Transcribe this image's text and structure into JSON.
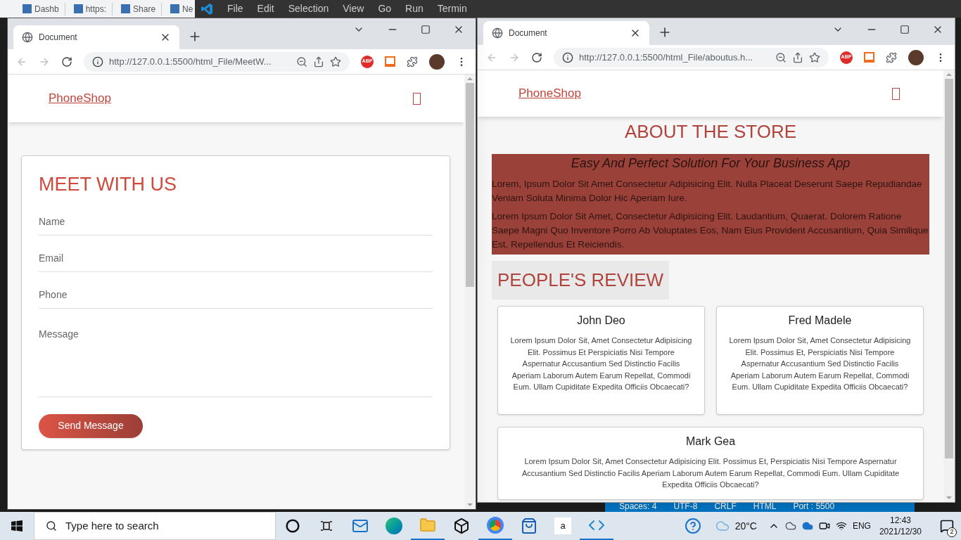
{
  "background": {
    "bookmarks": [
      "Dashb",
      "https:",
      "Share",
      "Ne"
    ],
    "vscode_menu": [
      "File",
      "Edit",
      "Selection",
      "View",
      "Go",
      "Run",
      "Termin"
    ],
    "vscode_status": [
      "Spaces: 4",
      "UTF-8",
      "CRLF",
      "HTML",
      "Port : 5500"
    ]
  },
  "left_window": {
    "tab": {
      "title": "Document"
    },
    "url": "http://127.0.0.1:5500/html_File/MeetW...",
    "adblock": "ABP",
    "page": {
      "brand": "PhoneShop",
      "form": {
        "title": "MEET WITH US",
        "fields": [
          {
            "kind": "input",
            "placeholder": "Name"
          },
          {
            "kind": "input",
            "placeholder": "Email"
          },
          {
            "kind": "input",
            "placeholder": "Phone"
          },
          {
            "kind": "textarea",
            "placeholder": "Message"
          }
        ],
        "button": "Send Message"
      }
    }
  },
  "right_window": {
    "tab": {
      "title": "Document"
    },
    "url": "http://127.0.0.1:5500/html_File/aboutus.h...",
    "adblock": "ABP",
    "page": {
      "brand": "PhoneShop",
      "title": "ABOUT THE STORE",
      "about": {
        "tagline": "Easy And Perfect Solution For Your Business App",
        "paragraphs": [
          "Lorem, Ipsum Dolor Sit Amet Consectetur Adipisicing Elit. Nulla Placeat Deserunt Saepe Repudiandae Veniam Soluta Minima Dolor Hic Aperiam Iure.",
          "Lorem Ipsum Dolor Sit Amet, Consectetur Adipisicing Elit. Laudantium, Quaerat. Dolorem Ratione Saepe Magni Quo Inventore Porro Ab Voluptates Eos, Nam Eius Provident Accusantium, Quia Similique Est, Repellendus Et Reiciendis."
        ]
      },
      "reviews_title": "PEOPLE'S REVIEW",
      "reviews": [
        {
          "name": "John Deo",
          "text": "Lorem Ipsum Dolor Sit, Amet Consectetur Adipisicing Elit. Possimus Et Perspiciatis Nisi Tempore Aspernatur Accusantium Sed Distinctio Facilis Aperiam Laborum Autem Earum Repellat, Commodi Eum. Ullam Cupiditate Expedita Officiis Obcaecati?"
        },
        {
          "name": "Fred Madele",
          "text": "Lorem Ipsum Dolor Sit, Amet Consectetur Adipisicing Elit. Possimus Et, Perspiciatis Nisi Tempore Aspernatur Accusantium Sed Distinctio Facilis Aperiam Laborum Autem Earum Repellat, Commodi Eum. Ullam Cupiditate Expedita Officiis Obcaecati?"
        },
        {
          "name": "Mark Gea",
          "text": "Lorem Ipsum Dolor Sit, Amet Consectetur Adipisicing Elit. Possimus Et, Perspiciatis Nisi Tempore Aspernatur Accusantium Sed Distinctio Facilis Aperiam Laborum Autem Earum Repellat, Commodi Eum. Ullam Cupiditate Expedita Officiis Obcaecati?"
        }
      ]
    }
  },
  "taskbar": {
    "search": {
      "placeholder": "Type here to search"
    },
    "store_label": "a",
    "temperature": "20°C",
    "language": "ENG",
    "time": "12:43",
    "date": "2021/12/30",
    "notifications": "2"
  }
}
